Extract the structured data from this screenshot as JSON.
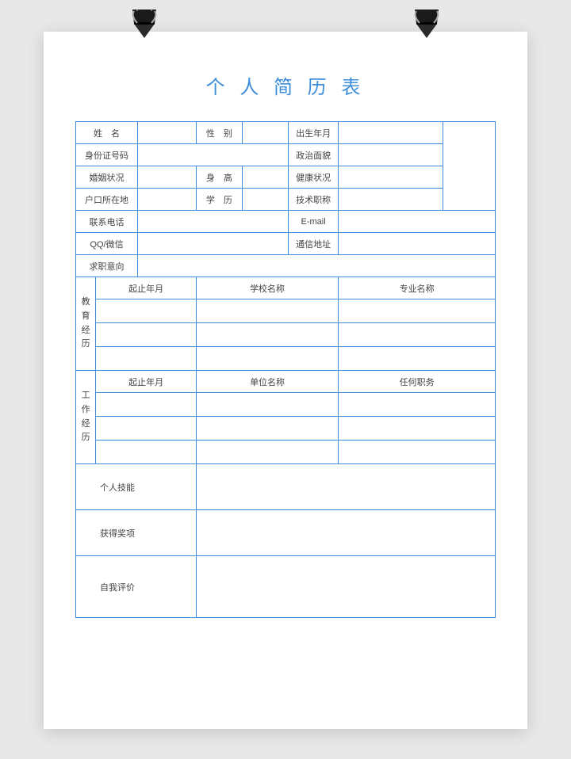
{
  "title": "个 人 简 历 表",
  "fields": {
    "name": "姓　名",
    "gender": "性　别",
    "birth": "出生年月",
    "idnum": "身份证号码",
    "political": "政治面貌",
    "marital": "婚姻状况",
    "height": "身　高",
    "health": "健康状况",
    "hukou": "户口所在地",
    "education": "学　历",
    "jobtitle": "技术职称",
    "phone": "联系电话",
    "email": "E-mail",
    "qq": "QQ/微信",
    "address": "通信地址",
    "intent": "求职意向",
    "eduexp": "教育经历",
    "workexp": "工作经历",
    "period": "起止年月",
    "school": "学校名称",
    "major": "专业名称",
    "company": "单位名称",
    "position": "任何职务",
    "skills": "个人技能",
    "awards": "获得奖项",
    "self": "自我评价"
  }
}
